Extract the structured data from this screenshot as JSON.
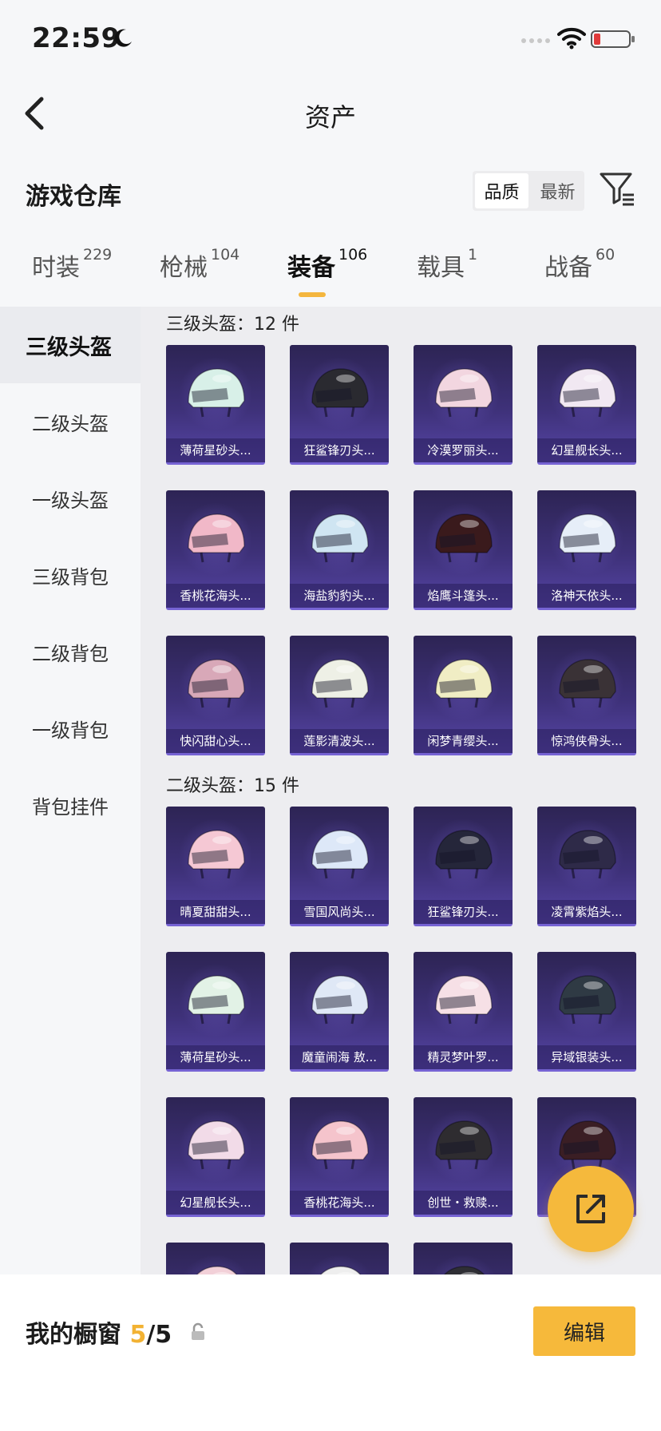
{
  "status_bar": {
    "time": "22:59"
  },
  "nav": {
    "title": "资产"
  },
  "warehouse": {
    "title": "游戏仓库",
    "sort_options": [
      "品质",
      "最新"
    ]
  },
  "tabs": [
    {
      "label": "时装",
      "count": "229"
    },
    {
      "label": "枪械",
      "count": "104"
    },
    {
      "label": "装备",
      "count": "106"
    },
    {
      "label": "载具",
      "count": "1"
    },
    {
      "label": "战备",
      "count": "60"
    }
  ],
  "sidebar": {
    "items": [
      {
        "label": "三级头盔"
      },
      {
        "label": "二级头盔"
      },
      {
        "label": "一级头盔"
      },
      {
        "label": "三级背包"
      },
      {
        "label": "二级背包"
      },
      {
        "label": "一级背包"
      },
      {
        "label": "背包挂件"
      }
    ]
  },
  "sections": [
    {
      "title": "三级头盔：12 件",
      "items": [
        {
          "name": "薄荷星砂头...",
          "color": "#d8f0e8"
        },
        {
          "name": "狂鲨锋刃头...",
          "color": "#2a2a30"
        },
        {
          "name": "冷漠罗丽头...",
          "color": "#f2d6e0"
        },
        {
          "name": "幻星舰长头...",
          "color": "#f1e8f2"
        },
        {
          "name": "香桃花海头...",
          "color": "#f1b8c8"
        },
        {
          "name": "海盐豹豹头...",
          "color": "#cfe5f2"
        },
        {
          "name": "焰鹰斗篷头...",
          "color": "#3a1a1c"
        },
        {
          "name": "洛神天依头...",
          "color": "#e6eef8"
        },
        {
          "name": "快闪甜心头...",
          "color": "#d8a8b8"
        },
        {
          "name": "莲影清波头...",
          "color": "#eef0e6"
        },
        {
          "name": "闲梦青缨头...",
          "color": "#f0edc4"
        },
        {
          "name": "惊鸿侠骨头...",
          "color": "#3a3236"
        }
      ]
    },
    {
      "title": "二级头盔：15 件",
      "items": [
        {
          "name": "晴夏甜甜头...",
          "color": "#f5c8d4"
        },
        {
          "name": "雪国风尚头...",
          "color": "#dde8f8"
        },
        {
          "name": "狂鲨锋刃头...",
          "color": "#25263a"
        },
        {
          "name": "凌霄紫焰头...",
          "color": "#2e2a48"
        },
        {
          "name": "薄荷星砂头...",
          "color": "#e2f2e6"
        },
        {
          "name": "魔童闹海 敖...",
          "color": "#dfe8f6"
        },
        {
          "name": "精灵梦叶罗...",
          "color": "#f6e0e6"
        },
        {
          "name": "异域银装头...",
          "color": "#2f3a44"
        },
        {
          "name": "幻星舰长头...",
          "color": "#f2dbe8"
        },
        {
          "name": "香桃花海头...",
          "color": "#f5c4cc"
        },
        {
          "name": "创世・救赎...",
          "color": "#2e2c30"
        },
        {
          "name": "",
          "color": "#3a1e24"
        },
        {
          "name": "",
          "color": "#f2d0d8"
        },
        {
          "name": "",
          "color": "#eeeeee"
        },
        {
          "name": "",
          "color": "#2e2e34"
        }
      ]
    }
  ],
  "showcase": {
    "label": "我的橱窗",
    "used": "5",
    "total": "/5",
    "edit_label": "编辑"
  },
  "colors": {
    "accent": "#f4b63e",
    "card_bg": "#3e3179"
  }
}
